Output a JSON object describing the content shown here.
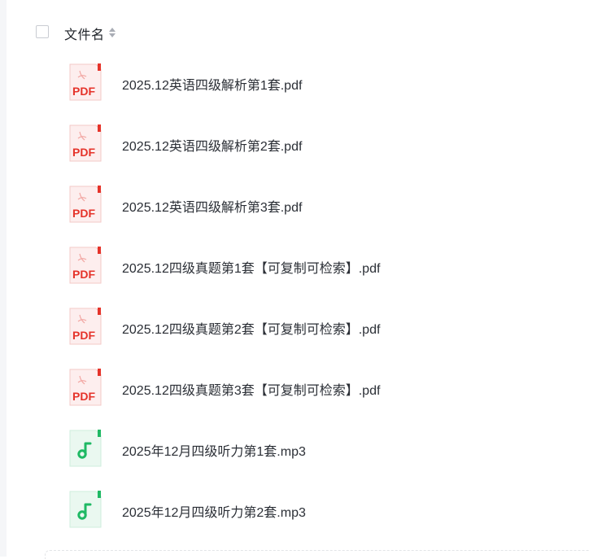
{
  "header": {
    "column_title": "文件名"
  },
  "files": [
    {
      "name": "2025.12英语四级解析第1套.pdf",
      "type": "pdf",
      "icon": "pdf-file-icon",
      "badge": "PDF"
    },
    {
      "name": "2025.12英语四级解析第2套.pdf",
      "type": "pdf",
      "icon": "pdf-file-icon",
      "badge": "PDF"
    },
    {
      "name": "2025.12英语四级解析第3套.pdf",
      "type": "pdf",
      "icon": "pdf-file-icon",
      "badge": "PDF"
    },
    {
      "name": "2025.12四级真题第1套【可复制可检索】.pdf",
      "type": "pdf",
      "icon": "pdf-file-icon",
      "badge": "PDF"
    },
    {
      "name": "2025.12四级真题第2套【可复制可检索】.pdf",
      "type": "pdf",
      "icon": "pdf-file-icon",
      "badge": "PDF"
    },
    {
      "name": "2025.12四级真题第3套【可复制可检索】.pdf",
      "type": "pdf",
      "icon": "pdf-file-icon",
      "badge": "PDF"
    },
    {
      "name": "2025年12月四级听力第1套.mp3",
      "type": "mp3",
      "icon": "audio-file-icon"
    },
    {
      "name": "2025年12月四级听力第2套.mp3",
      "type": "mp3",
      "icon": "audio-file-icon"
    }
  ],
  "colors": {
    "pdf_red": "#e5332a",
    "pdf_bg": "#fdeeee",
    "audio_green": "#1fb964",
    "audio_bg": "#eaf8f0",
    "text": "#2b2f36"
  }
}
